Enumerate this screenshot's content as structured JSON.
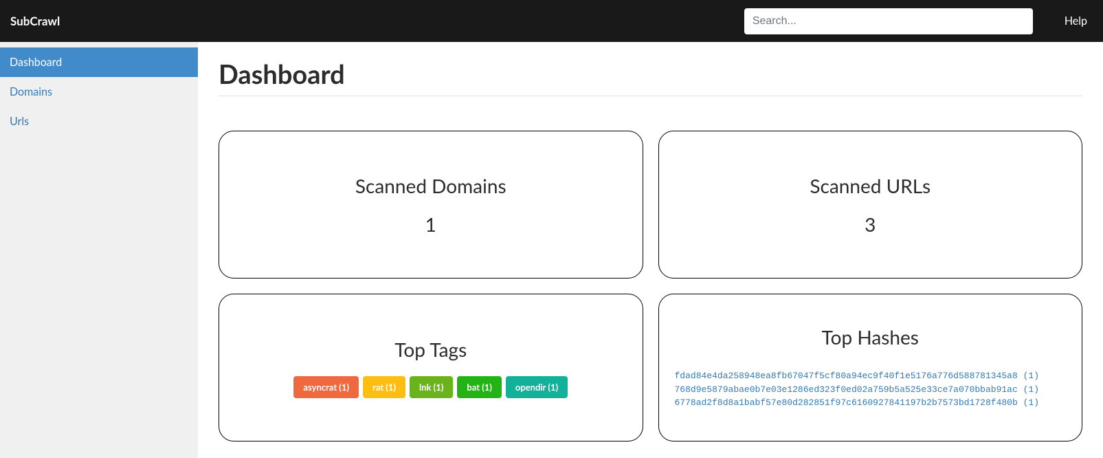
{
  "navbar": {
    "brand": "SubCrawl",
    "search_placeholder": "Search...",
    "help_label": "Help"
  },
  "sidebar": {
    "items": [
      {
        "label": "Dashboard",
        "active": true
      },
      {
        "label": "Domains",
        "active": false
      },
      {
        "label": "Urls",
        "active": false
      }
    ]
  },
  "page": {
    "title": "Dashboard"
  },
  "cards": {
    "scanned_domains": {
      "title": "Scanned Domains",
      "value": "1"
    },
    "scanned_urls": {
      "title": "Scanned URLs",
      "value": "3"
    },
    "top_tags": {
      "title": "Top Tags",
      "tags": [
        {
          "label": "asyncrat (1)",
          "color": "tag-orange"
        },
        {
          "label": "rat (1)",
          "color": "tag-yellow"
        },
        {
          "label": "lnk (1)",
          "color": "tag-green1"
        },
        {
          "label": "bat (1)",
          "color": "tag-green2"
        },
        {
          "label": "opendir (1)",
          "color": "tag-teal"
        }
      ]
    },
    "top_hashes": {
      "title": "Top Hashes",
      "hashes": [
        {
          "hash": "fdad84e4da258948ea8fb67047f5cf80a94ec9f40f1e5176a776d588781345a8",
          "count": "(1)"
        },
        {
          "hash": "768d9e5879abae0b7e03e1286ed323f0ed02a759b5a525e33ce7a070bbab91ac",
          "count": "(1)"
        },
        {
          "hash": "6778ad2f8d8a1babf57e80d282851f97c6160927841197b2b7573bd1728f480b",
          "count": "(1)"
        }
      ]
    }
  }
}
